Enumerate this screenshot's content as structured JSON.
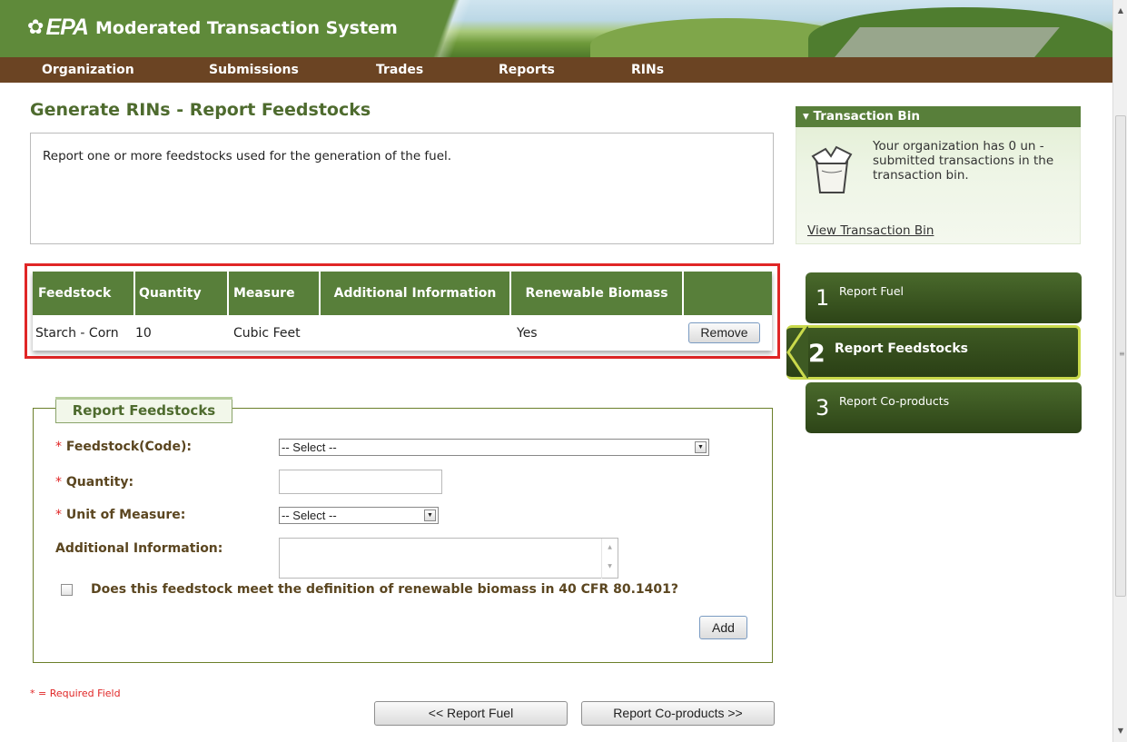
{
  "header": {
    "logo_text": "EPA",
    "app_title": "Moderated Transaction System"
  },
  "nav": {
    "items": [
      "Organization",
      "Submissions",
      "Trades",
      "Reports",
      "RINs"
    ]
  },
  "page": {
    "title": "Generate RINs - Report Feedstocks",
    "description": "Report one or more feedstocks used for the generation of the fuel."
  },
  "table": {
    "headers": [
      "Feedstock",
      "Quantity",
      "Measure",
      "Additional Information",
      "Renewable Biomass",
      ""
    ],
    "rows": [
      {
        "feedstock": "Starch - Corn",
        "quantity": "10",
        "measure": "Cubic Feet",
        "additional": "",
        "renewable": "Yes",
        "action": "Remove"
      }
    ]
  },
  "form": {
    "legend": "Report Feedstocks",
    "required_marker": "*",
    "feedstock_label": "Feedstock(Code):",
    "feedstock_value": "-- Select --",
    "quantity_label": "Quantity:",
    "quantity_value": "",
    "unit_label": "Unit of Measure:",
    "unit_value": "-- Select --",
    "additional_label": "Additional Information:",
    "additional_value": "",
    "biomass_question": "Does this feedstock meet the definition of renewable biomass in 40 CFR 80.1401?",
    "biomass_checked": false,
    "add_button": "Add"
  },
  "footer": {
    "required_note": "* = Required Field",
    "prev_button": "<< Report Fuel",
    "next_button": "Report Co-products >>"
  },
  "transaction_bin": {
    "title": "Transaction Bin",
    "message": "Your organization has 0 un -submitted transactions in the transaction bin.",
    "link": "View Transaction Bin"
  },
  "steps": [
    {
      "number": "1",
      "label": "Report Fuel",
      "active": false
    },
    {
      "number": "2",
      "label": "Report Feedstocks",
      "active": true
    },
    {
      "number": "3",
      "label": "Report Co-products",
      "active": false
    }
  ],
  "colors": {
    "header_green": "#5f8a3a",
    "nav_brown": "#6b4423",
    "table_header_green": "#587f3a",
    "title_green": "#4e6b2e",
    "highlight_red": "#e02626",
    "active_step_border": "#c9d94b"
  }
}
